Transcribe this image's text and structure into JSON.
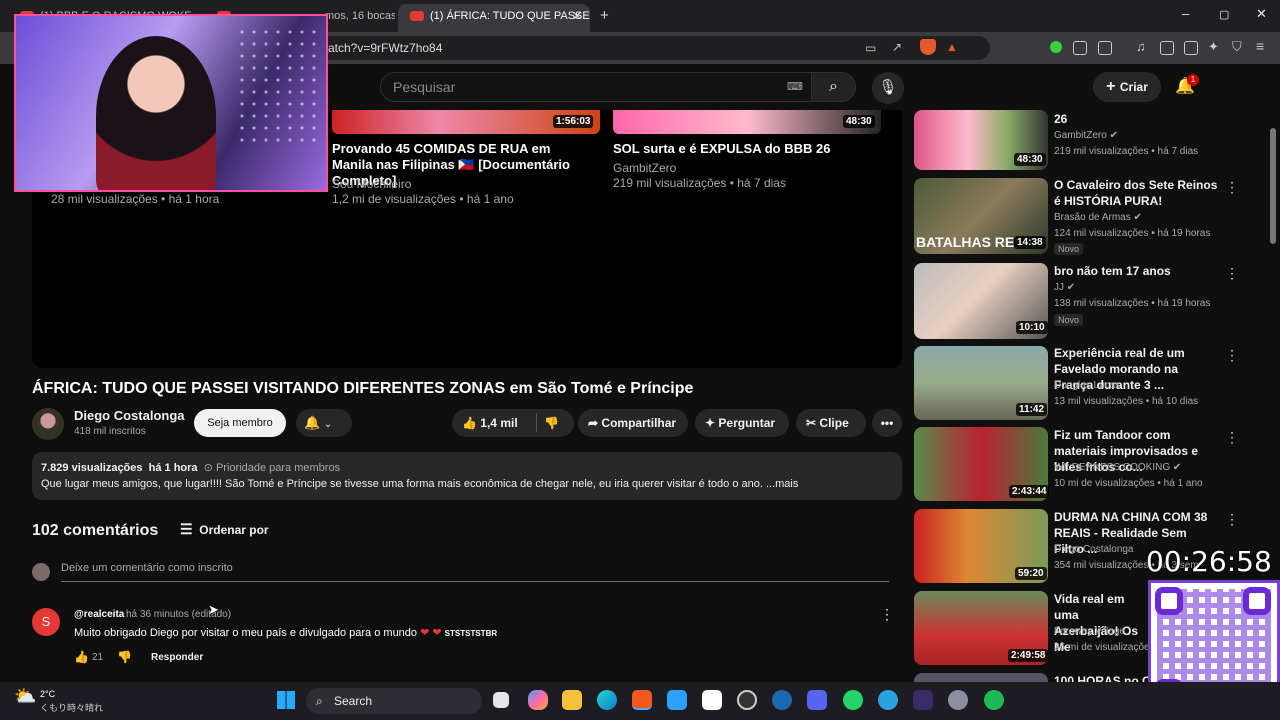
{
  "browser": {
    "tabs": [
      {
        "label": "(1) BBB E O RACISMO WOKE - YouT"
      },
      {
        "label": "mos, 16 bocas"
      },
      {
        "label": "(1) ÁFRICA: TUDO QUE PASSEI V"
      }
    ],
    "url": "atch?v=9rFWtz7ho84",
    "window_controls": [
      "–",
      "▢",
      "✕"
    ]
  },
  "youtube_header": {
    "search_placeholder": "Pesquisar",
    "create_label": "Criar",
    "notifications_count": "1"
  },
  "end_screen": [
    {
      "title": "",
      "channel": "",
      "meta": "28 mil visualizações • há 1 hora",
      "duration": ""
    },
    {
      "title": "Provando 45 COMIDAS DE RUA em Manila nas Filipinas 🇵🇭 [Documentário Completo]",
      "channel": "Sou Mochileiro",
      "meta": "1,2 mi de visualizações • há 1 ano",
      "duration": "1:56:03"
    },
    {
      "title": "SOL surta e é EXPULSA do BBB 26",
      "channel": "GambitZero",
      "meta": "219 mil visualizações • há 7 dias",
      "duration": "48:30"
    }
  ],
  "video": {
    "title": "ÁFRICA: TUDO QUE PASSEI VISITANDO DIFERENTES ZONAS em São Tomé e Príncipe",
    "channel": "Diego Costalonga",
    "subscribers": "418 mil inscritos",
    "join_label": "Seja membro",
    "likes": "1,4 mil",
    "share_label": "Compartilhar",
    "ask_label": "Perguntar",
    "clip_label": "Clipe",
    "views": "7.829 visualizações",
    "age": "há 1 hora",
    "priority": "Prioridade para membros",
    "description": "Que lugar meus amigos, que lugar!!!! São Tomé e Príncipe se tivesse uma forma mais econômica de chegar nele, eu iria querer visitar é todo o ano. ...mais"
  },
  "comments": {
    "count_label": "102 comentários",
    "sort_label": "Ordenar por",
    "input_placeholder": "Deixe um comentário como inscrito",
    "items": [
      {
        "avatar_letter": "S",
        "author": "@realceita",
        "time": "há 36 minutos (editado)",
        "text": "Muito obrigado Diego por visitar o meu país e divulgado para o mundo",
        "suffix": "STSTSTSTBR",
        "likes": "21",
        "reply_label": "Responder"
      }
    ]
  },
  "sidebar": [
    {
      "title": "26",
      "channel": "GambitZero",
      "meta": "219 mil visualizações • há 7 dias",
      "duration": "48:30",
      "badge": ""
    },
    {
      "title": "O Cavaleiro dos Sete Reinos é HISTÓRIA PURA!",
      "channel": "Brasão de Armas",
      "meta": "124 mil visualizações • há 19 horas",
      "duration": "14:38",
      "badge": "Novo",
      "thumb_text": "BATALHAS RE"
    },
    {
      "title": "bro não tem 17 anos",
      "channel": "JJ",
      "meta": "138 mil visualizações • há 19 horas",
      "duration": "10:10",
      "badge": "Novo"
    },
    {
      "title": "Experiência real de um Favelado morando na França durante 3 ...",
      "channel": "Douglas Lucas",
      "meta": "13 mil visualizações • há 10 dias",
      "duration": "11:42",
      "badge": ""
    },
    {
      "title": "Fiz um Tandoor com materiais improvisados e bifes fritos co...",
      "channel": "WILDERNESS COOKING",
      "meta": "10 mi de visualizações • há 1 ano",
      "duration": "2:43:44",
      "badge": ""
    },
    {
      "title": "DURMA NA CHINA COM 38 REAIS - Realidade Sem Filtro ...",
      "channel": "Diego Costalonga",
      "meta": "354 mil visualizações • há 3 sem",
      "duration": "59:20",
      "badge": ""
    },
    {
      "title": "Vida real em uma Azerbaijão! Os Me",
      "channel": "Faraway Village",
      "meta": "25 mi de visualizações",
      "duration": "2:49:58",
      "badge": ""
    },
    {
      "title": "100 HORAS no Ca",
      "channel": "",
      "meta": "",
      "duration": "",
      "badge": ""
    }
  ],
  "overlay": {
    "timer": "00:26:58"
  },
  "taskbar": {
    "temperature": "2°C",
    "weather_text": "くもり時々晴れ",
    "search_label": "Search"
  },
  "colors": {
    "accent_red": "#cc0000",
    "webcam_border": "#ff4fa0",
    "qr_purple": "#6a2bd4"
  }
}
